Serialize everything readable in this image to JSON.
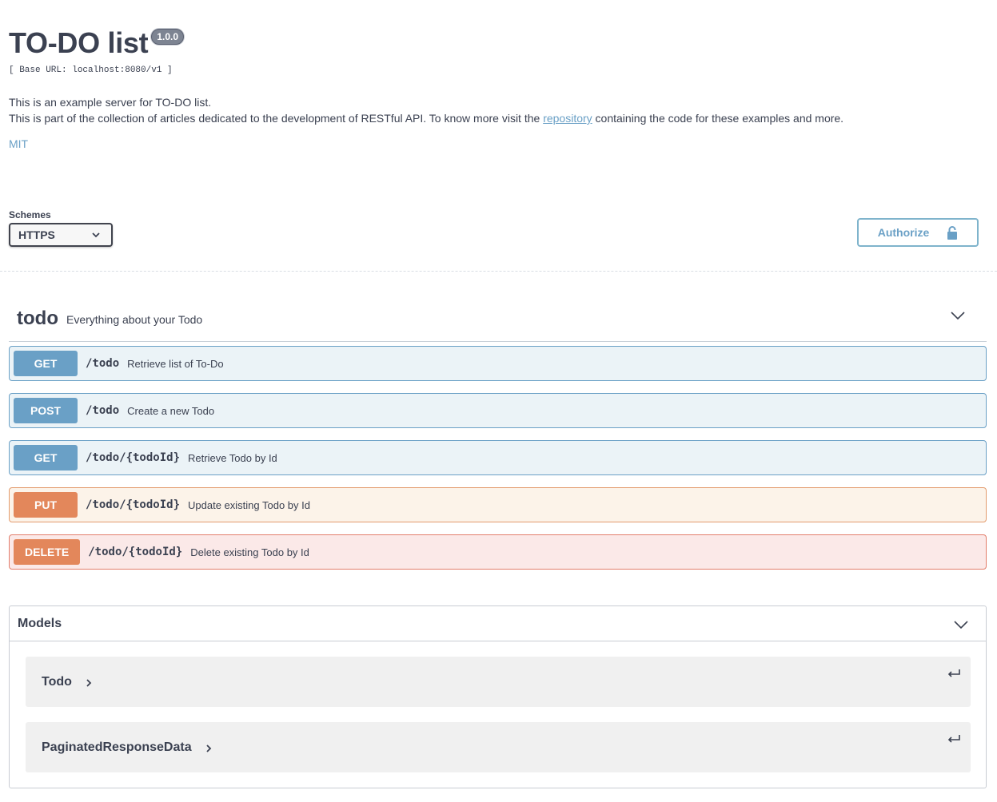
{
  "info": {
    "title": "TO-DO list",
    "version": "1.0.0",
    "base_url": "[ Base URL: localhost:8080/v1 ]",
    "description_line1": "This is an example server for TO-DO list.",
    "description_line2_before": "This is part of the collection of articles dedicated to the development of RESTful API. To know more visit the ",
    "description_link": "repository",
    "description_line2_after": " containing the code for these examples and more.",
    "license": "MIT"
  },
  "schemes": {
    "label": "Schemes",
    "selected": "HTTPS"
  },
  "authorize": {
    "label": "Authorize",
    "icon": "lock-icon"
  },
  "tag": {
    "name": "todo",
    "description": "Everything about your Todo"
  },
  "operations": [
    {
      "method": "GET",
      "path": "/todo",
      "summary": "Retrieve list of To-Do"
    },
    {
      "method": "POST",
      "path": "/todo",
      "summary": "Create a new Todo"
    },
    {
      "method": "GET",
      "path": "/todo/{todoId}",
      "summary": "Retrieve Todo by Id"
    },
    {
      "method": "PUT",
      "path": "/todo/{todoId}",
      "summary": "Update existing Todo by Id"
    },
    {
      "method": "DELETE",
      "path": "/todo/{todoId}",
      "summary": "Delete existing Todo by Id"
    }
  ],
  "models": {
    "title": "Models",
    "items": [
      {
        "name": "Todo"
      },
      {
        "name": "PaginatedResponseData"
      }
    ]
  },
  "colors": {
    "get": "#6aa0c6",
    "put": "#e3875b",
    "delete_bg": "#fbe9e8",
    "text": "#3b4151"
  }
}
